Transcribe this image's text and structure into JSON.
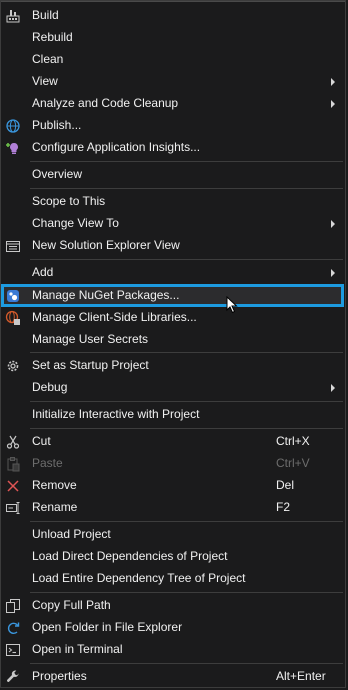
{
  "menu": {
    "items": [
      {
        "label": "Build",
        "icon": "build-icon"
      },
      {
        "label": "Rebuild"
      },
      {
        "label": "Clean"
      },
      {
        "label": "View",
        "submenu": true
      },
      {
        "label": "Analyze and Code Cleanup",
        "submenu": true
      },
      {
        "label": "Publish...",
        "icon": "globe-publish-icon"
      },
      {
        "label": "Configure Application Insights...",
        "icon": "app-insights-icon"
      },
      {
        "label": "Overview"
      },
      {
        "label": "Scope to This"
      },
      {
        "label": "Change View To",
        "submenu": true
      },
      {
        "label": "New Solution Explorer View",
        "icon": "solution-explorer-icon"
      },
      {
        "label": "Add",
        "submenu": true
      },
      {
        "label": "Manage NuGet Packages...",
        "icon": "nuget-icon",
        "highlighted": true
      },
      {
        "label": "Manage Client-Side Libraries...",
        "icon": "client-libraries-icon"
      },
      {
        "label": "Manage User Secrets"
      },
      {
        "label": "Set as Startup Project",
        "icon": "gear-icon"
      },
      {
        "label": "Debug",
        "submenu": true
      },
      {
        "label": "Initialize Interactive with Project"
      },
      {
        "label": "Cut",
        "shortcut": "Ctrl+X",
        "icon": "scissors-icon"
      },
      {
        "label": "Paste",
        "shortcut": "Ctrl+V",
        "icon": "paste-icon",
        "disabled": true
      },
      {
        "label": "Remove",
        "shortcut": "Del",
        "icon": "remove-x-icon"
      },
      {
        "label": "Rename",
        "shortcut": "F2",
        "icon": "rename-icon"
      },
      {
        "label": "Unload Project"
      },
      {
        "label": "Load Direct Dependencies of Project"
      },
      {
        "label": "Load Entire Dependency Tree of Project"
      },
      {
        "label": "Copy Full Path",
        "icon": "copy-icon"
      },
      {
        "label": "Open Folder in File Explorer",
        "icon": "open-folder-icon"
      },
      {
        "label": "Open in Terminal",
        "icon": "terminal-icon"
      },
      {
        "label": "Properties",
        "shortcut": "Alt+Enter",
        "icon": "wrench-icon"
      }
    ]
  },
  "colors": {
    "background": "#1b1b1c",
    "text": "#f1f1f1",
    "disabled_text": "#6d6d6d",
    "highlight_border": "#1d9be0",
    "separator": "#3d3d3d"
  }
}
